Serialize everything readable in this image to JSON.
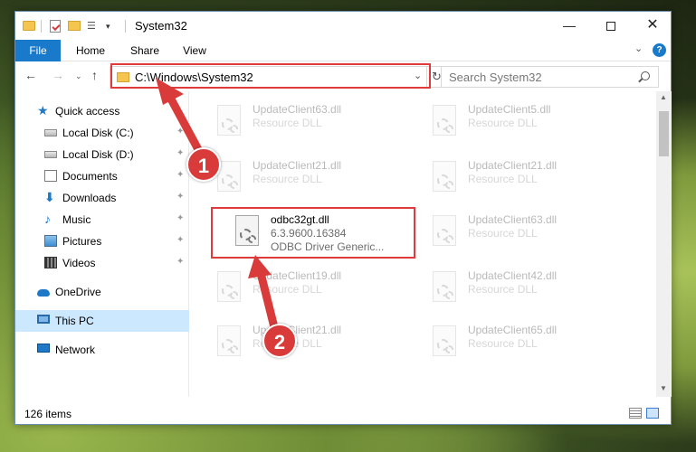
{
  "window": {
    "title": "System32",
    "controls": {
      "minimize": "—",
      "maximize": "",
      "close": "✕"
    }
  },
  "quick_access_toolbar": {
    "customize_arrow": "▾"
  },
  "ribbon": {
    "tabs": [
      {
        "label": "File",
        "active": true
      },
      {
        "label": "Home"
      },
      {
        "label": "Share"
      },
      {
        "label": "View"
      }
    ],
    "expand_glyph": "⌄",
    "help_glyph": "?"
  },
  "navigation_buttons": {
    "back": "←",
    "forward": "→",
    "recent": "⌄",
    "up": "↑"
  },
  "address": {
    "path": "C:\\Windows\\System32",
    "dropdown_glyph": "⌄",
    "refresh_glyph": "↻"
  },
  "search": {
    "placeholder": "Search System32"
  },
  "nav_pane": {
    "items": [
      {
        "label": "Quick access",
        "icon": "star-icon",
        "pinned": false
      },
      {
        "label": "Local Disk (C:)",
        "icon": "disk-icon",
        "pinned": true
      },
      {
        "label": "Local Disk (D:)",
        "icon": "disk-icon",
        "pinned": true
      },
      {
        "label": "Documents",
        "icon": "documents-icon",
        "pinned": true
      },
      {
        "label": "Downloads",
        "icon": "download-icon",
        "pinned": true
      },
      {
        "label": "Music",
        "icon": "music-icon",
        "pinned": true
      },
      {
        "label": "Pictures",
        "icon": "pictures-icon",
        "pinned": true
      },
      {
        "label": "Videos",
        "icon": "videos-icon",
        "pinned": true
      },
      {
        "label": "OneDrive",
        "icon": "onedrive-icon",
        "pinned": false
      },
      {
        "label": "This PC",
        "icon": "this-pc-icon",
        "pinned": false,
        "selected": true
      },
      {
        "label": "Network",
        "icon": "network-icon",
        "pinned": false
      }
    ],
    "pin_glyph": "📌"
  },
  "files": {
    "left_column": [
      {
        "name": "UpdateClient63.dll",
        "type": "Resource DLL"
      },
      {
        "name": "UpdateClient21.dll",
        "type": "Resource DLL"
      },
      {
        "name": "odbc32gt.dll",
        "version": "6.3.9600.16384",
        "type": "ODBC Driver Generic...",
        "highlighted": true
      },
      {
        "name": "UpdateClient19.dll",
        "type": "Resource DLL"
      },
      {
        "name": "UpdateClient21.dll",
        "type": "Resource DLL"
      }
    ],
    "right_column": [
      {
        "name": "UpdateClient5.dll",
        "type": "Resource DLL"
      },
      {
        "name": "UpdateClient21.dll",
        "type": "Resource DLL"
      },
      {
        "name": "UpdateClient63.dll",
        "type": "Resource DLL"
      },
      {
        "name": "UpdateClient42.dll",
        "type": "Resource DLL"
      },
      {
        "name": "UpdateClient65.dll",
        "type": "Resource DLL"
      }
    ]
  },
  "status_bar": {
    "item_count": "126 items"
  },
  "annotations": {
    "step_1": "1",
    "step_2": "2",
    "color": "#d93b3b"
  }
}
